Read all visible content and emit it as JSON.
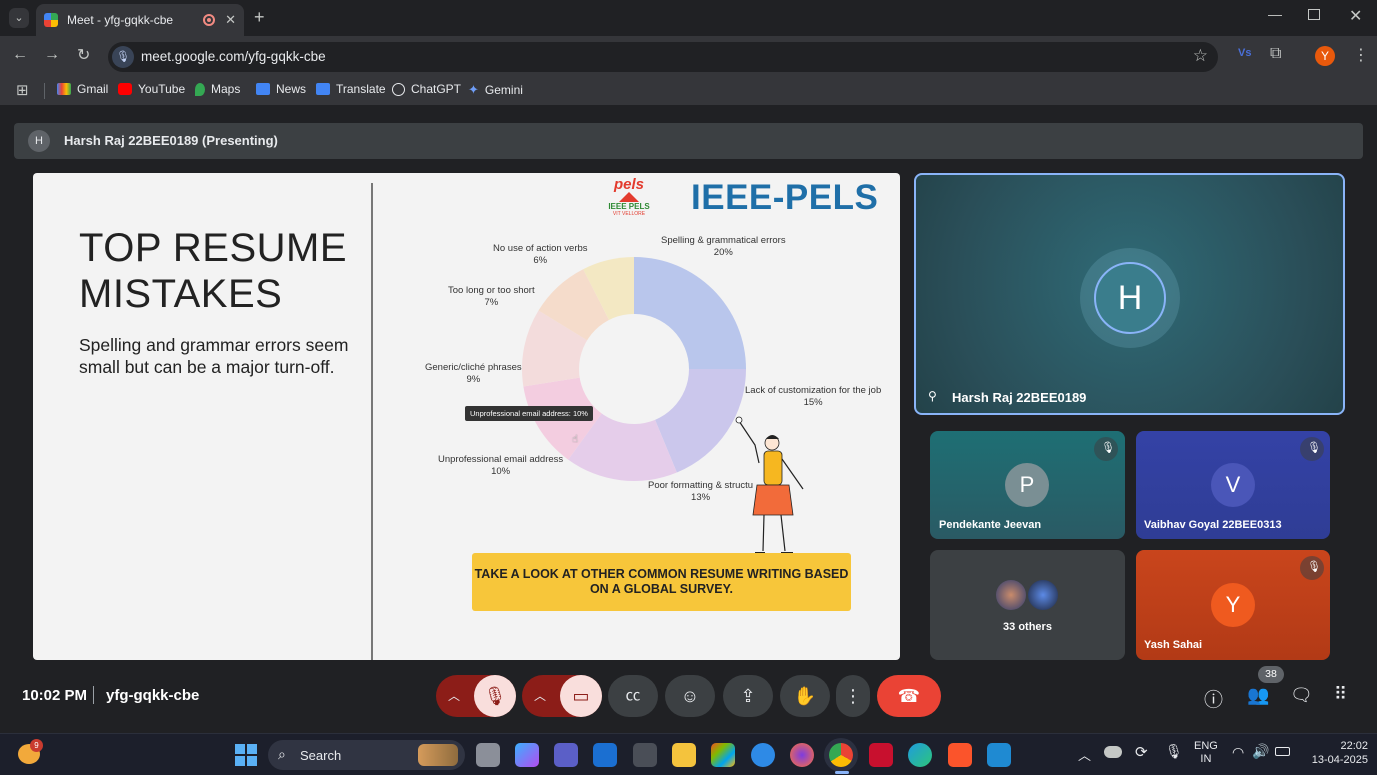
{
  "browser": {
    "tab_title": "Meet - yfg-gqkk-cbe",
    "url": "meet.google.com/yfg-gqkk-cbe",
    "bookmarks": [
      "Gmail",
      "YouTube",
      "Maps",
      "News",
      "Translate",
      "ChatGPT",
      "Gemini"
    ],
    "profile_initial": "Y"
  },
  "meet": {
    "presenter_bar": {
      "avatar": "H",
      "label": "Harsh Raj 22BEE0189 (Presenting)"
    },
    "slide": {
      "heading": "TOP RESUME MISTAKES",
      "subtext": "Spelling and grammar errors seem small but can be a major turn-off.",
      "logo_text": "pels",
      "logo_sub": "IEEE PELS",
      "logo_small": "VIT VELLORE",
      "org_title": "IEEE-PELS",
      "tooltip": "Unprofessional email address: 10%",
      "cta": "TAKE A LOOK AT OTHER COMMON RESUME WRITING BASED ON A GLOBAL SURVEY.",
      "chart_data": {
        "type": "pie",
        "categories": [
          "Spelling & grammatical errors",
          "Lack of customization for the job",
          "Poor formatting & structure",
          "Unprofessional email address",
          "Generic/cliché phrases",
          "Too long or too short",
          "No use of action verbs"
        ],
        "values": [
          20,
          15,
          13,
          10,
          9,
          7,
          6
        ],
        "colors": [
          "#b9c6ec",
          "#cbc7ec",
          "#e5cdea",
          "#f3cde0",
          "#f3dcdc",
          "#f5dccb",
          "#f3e8c3"
        ],
        "label_lines": [
          [
            "Spelling & grammatical errors",
            "20%"
          ],
          [
            "Lack of customization for the job",
            "15%"
          ],
          [
            "Poor formatting & structu",
            "13%"
          ],
          [
            "Unprofessional email address",
            "10%"
          ],
          [
            "Generic/cliché phrases",
            "9%"
          ],
          [
            "Too long or too short",
            "7%"
          ],
          [
            "No use of action verbs",
            "6%"
          ]
        ]
      }
    },
    "tiles": {
      "main": {
        "initial": "H",
        "name": "Harsh Raj 22BEE0189"
      },
      "p1": {
        "initial": "P",
        "name": "Pendekante Jeevan"
      },
      "p2": {
        "initial": "V",
        "name": "Vaibhav Goyal 22BEE0313"
      },
      "others": {
        "label": "33 others"
      },
      "p3": {
        "initial": "Y",
        "name": "Yash Sahai"
      }
    },
    "footer": {
      "time": "10:02 PM",
      "meeting_code": "yfg-gqkk-cbe",
      "participants_count": "38"
    }
  },
  "taskbar": {
    "search_placeholder": "Search",
    "weather_badge": "9",
    "lang": "ENG",
    "region": "IN",
    "clock_time": "22:02",
    "clock_date": "13-04-2025"
  }
}
